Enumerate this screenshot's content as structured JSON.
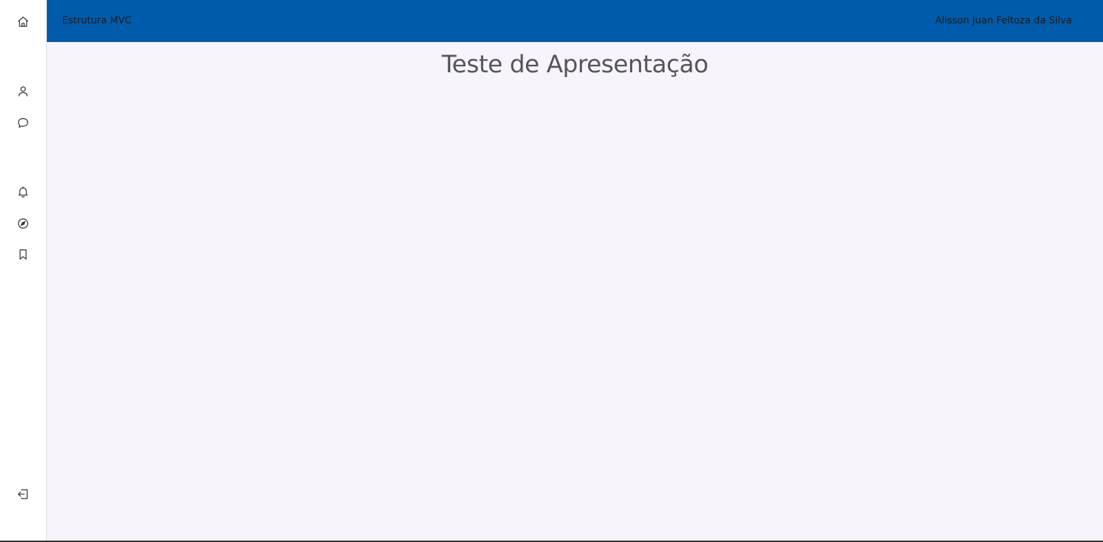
{
  "header": {
    "brand": "Estrutura MVC",
    "user_name": "Alisson Juan Feitoza da Silva",
    "background_color": "#005baa"
  },
  "sidebar": {
    "items": [
      {
        "icon": "home-icon"
      },
      {
        "icon": "user-icon"
      },
      {
        "icon": "chat-bubble-icon"
      },
      {
        "icon": "bell-icon"
      },
      {
        "icon": "compass-icon"
      },
      {
        "icon": "bookmark-icon"
      },
      {
        "icon": "logout-icon"
      }
    ]
  },
  "main": {
    "title": "Teste de Apresentação",
    "background_color": "#f7f4fb"
  }
}
